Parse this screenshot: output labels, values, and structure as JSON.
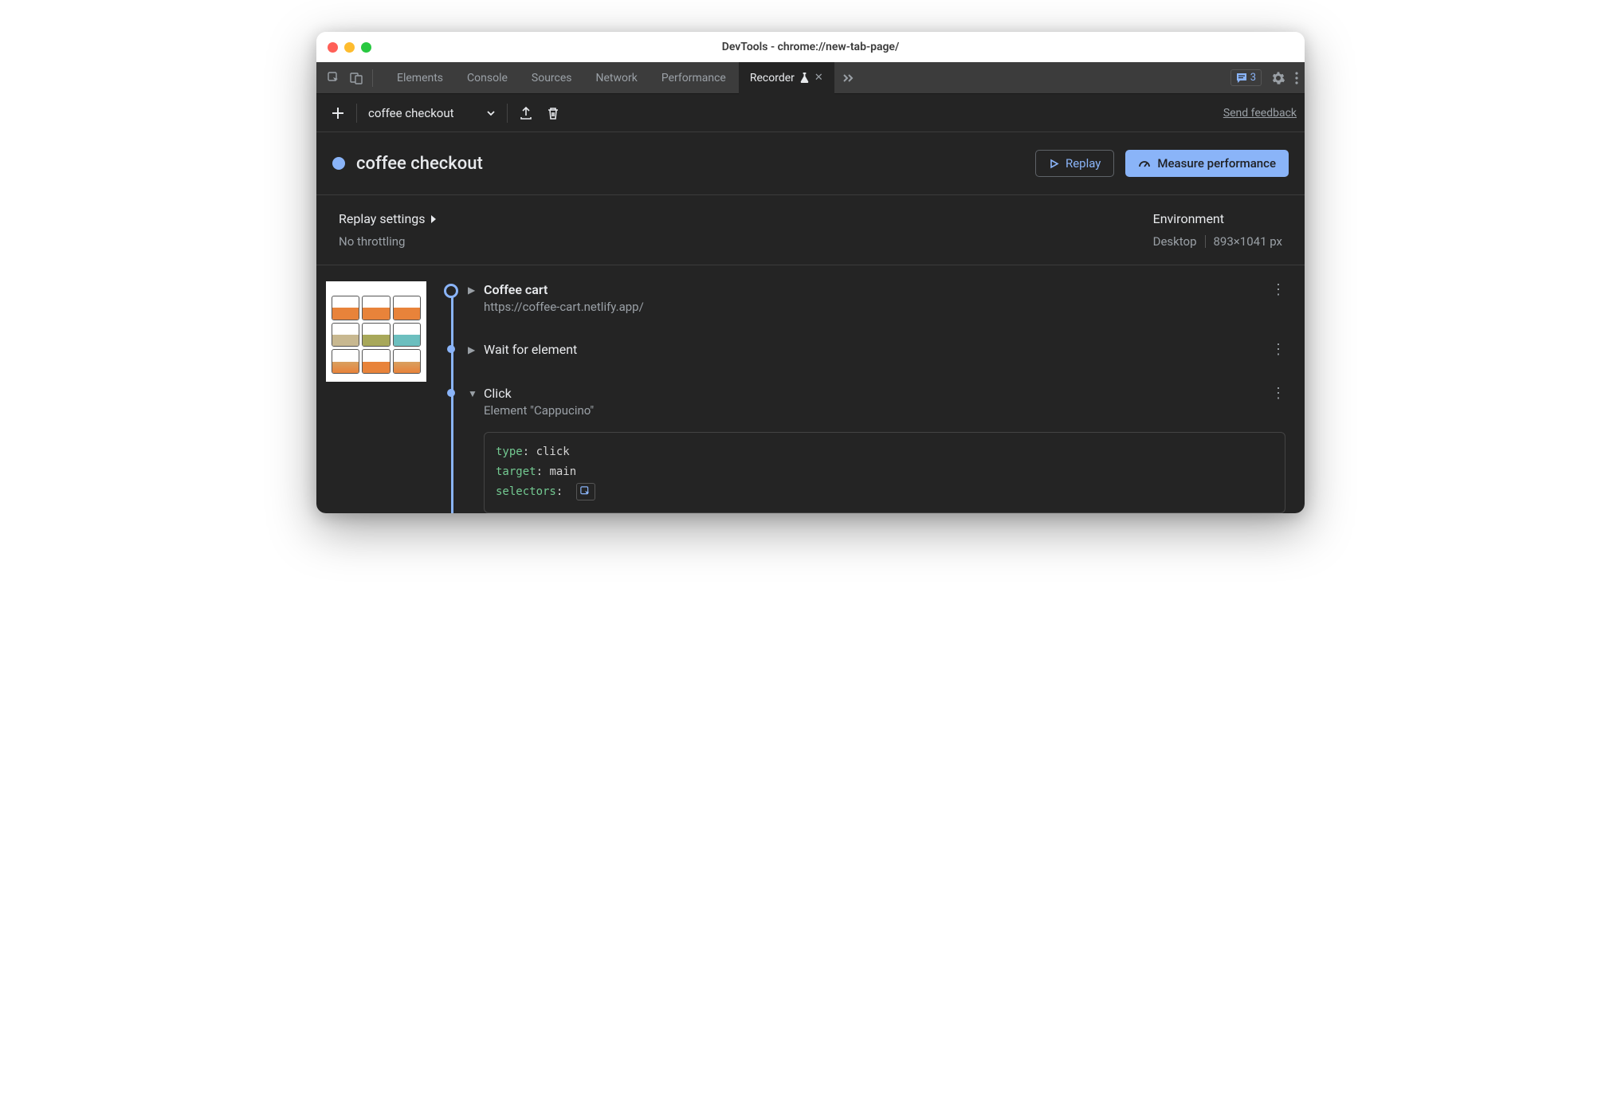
{
  "window": {
    "title": "DevTools - chrome://new-tab-page/"
  },
  "tabs": {
    "items": [
      "Elements",
      "Console",
      "Sources",
      "Network",
      "Performance",
      "Recorder"
    ],
    "active": "Recorder",
    "issues_count": "3"
  },
  "toolbar": {
    "recording_name": "coffee checkout",
    "feedback": "Send feedback"
  },
  "header": {
    "title": "coffee checkout",
    "replay_label": "Replay",
    "measure_label": "Measure performance"
  },
  "settings": {
    "replay_title": "Replay settings",
    "throttling": "No throttling",
    "env_title": "Environment",
    "device": "Desktop",
    "resolution": "893×1041 px"
  },
  "steps": {
    "s0": {
      "title": "Coffee cart",
      "url": "https://coffee-cart.netlify.app/"
    },
    "s1": {
      "title": "Wait for element"
    },
    "s2": {
      "title": "Click",
      "subtitle": "Element \"Cappucino\"",
      "code": {
        "type_k": "type",
        "type_v": "click",
        "target_k": "target",
        "target_v": "main",
        "selectors_k": "selectors"
      }
    }
  }
}
